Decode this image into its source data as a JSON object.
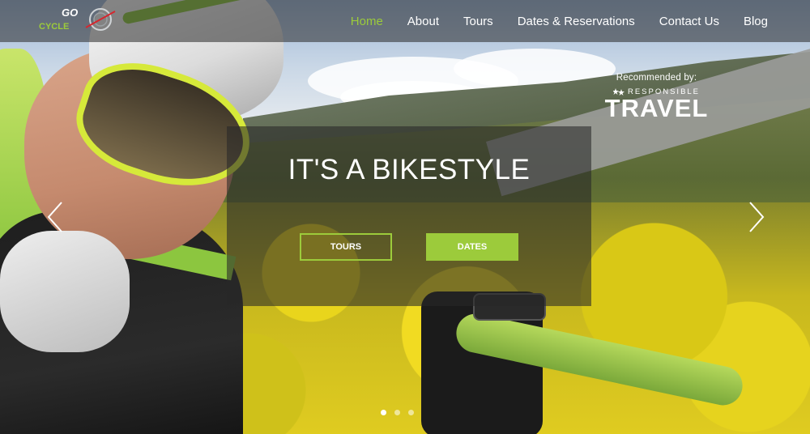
{
  "logo": {
    "text_top": "GO",
    "text_bottom": "CYCLE",
    "icon": "bicycle-logo-icon"
  },
  "nav": {
    "items": [
      {
        "label": "Home",
        "active": true
      },
      {
        "label": "About",
        "active": false
      },
      {
        "label": "Tours",
        "active": false
      },
      {
        "label": "Dates & Reservations",
        "active": false
      },
      {
        "label": "Contact Us",
        "active": false
      },
      {
        "label": "Blog",
        "active": false
      }
    ]
  },
  "badge": {
    "label": "Recommended by:",
    "sub": "RESPONSIBLE",
    "main": "TRAVEL",
    "icon": "responsible-travel-stars-icon"
  },
  "hero": {
    "headline": "IT'S A BIKESTYLE",
    "buttons": {
      "tours": "TOURS",
      "dates": "DATES"
    }
  },
  "slider": {
    "prev_icon": "chevron-left-icon",
    "next_icon": "chevron-right-icon",
    "slides": 3,
    "current": 1
  },
  "colors": {
    "accent": "#9ccb3b",
    "nav_bg": "rgba(40,40,40,0.55)",
    "text": "#ffffff"
  }
}
